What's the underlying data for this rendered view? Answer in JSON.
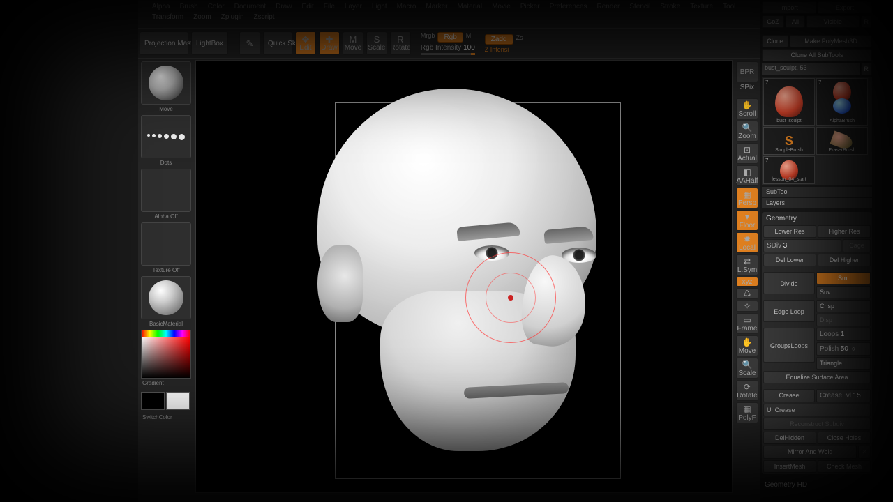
{
  "menu": [
    "Alpha",
    "Brush",
    "Color",
    "Document",
    "Draw",
    "Edit",
    "File",
    "Layer",
    "Light",
    "Macro",
    "Marker",
    "Material",
    "Movie",
    "Picker",
    "Preferences",
    "Render",
    "Stencil",
    "Stroke",
    "Texture",
    "Tool",
    "Transform",
    "Zoom",
    "Zplugin",
    "Zscript"
  ],
  "topbar": {
    "projection": "Projection Master",
    "lightbox": "LightBox",
    "quicksketch": "Quick Sketch",
    "edit": "Edit",
    "draw": "Draw",
    "move": "Move",
    "scale": "Scale",
    "rotate": "Rotate",
    "mrgb": "Mrgb",
    "rgb": "Rgb",
    "m": "M",
    "rgbint_lbl": "Rgb Intensity",
    "rgbint_val": "100",
    "zadd": "Zadd",
    "zs": "Zs",
    "zint": "Z Intensi"
  },
  "left": {
    "brush": "Move",
    "stroke": "Dots",
    "alpha": "Alpha Off",
    "texture": "Texture Off",
    "material": "BasicMaterial",
    "gradient": "Gradient",
    "switch": "SwitchColor"
  },
  "rnav": {
    "bpr": "BPR",
    "spix": "SPix",
    "scroll": "Scroll",
    "zoom": "Zoom",
    "actual": "Actual",
    "aahalf": "AAHalf",
    "persp": "Persp",
    "floor": "Floor",
    "local": "Local",
    "lsym": "L.Sym",
    "xyz": "xyz",
    "frame": "Frame",
    "move": "Move",
    "scale": "Scale",
    "rotate": "Rotate",
    "polyf": "PolyF"
  },
  "rp": {
    "import": "Import",
    "export": "Export",
    "goz": "GoZ",
    "all": "All",
    "visible": "Visible",
    "r": "R",
    "clone": "Clone",
    "makepoly": "Make PolyMesh3D",
    "cloneall": "Clone All SubTools",
    "toolname": "bust_sculpt. 53",
    "subtools": [
      {
        "n": "7",
        "lbl": "bust_sculpt",
        "kind": "head"
      },
      {
        "n": "7",
        "lbl": "bust_sculpt",
        "kind": "head2"
      },
      {
        "n": "",
        "lbl": "AlphaBrush",
        "kind": "sphere"
      },
      {
        "n": "",
        "lbl": "SimpleBrush",
        "kind": "s"
      },
      {
        "n": "",
        "lbl": "EraserBrush",
        "kind": "e"
      },
      {
        "n": "7",
        "lbl": "lesson_04_start",
        "kind": "headsm"
      }
    ],
    "subtool_hdr": "SubTool",
    "layers_hdr": "Layers",
    "geometry": "Geometry",
    "lowerres": "Lower Res",
    "higherres": "Higher Res",
    "sdiv_lbl": "SDiv",
    "sdiv_val": "3",
    "cage": "Cage",
    "dellower": "Del Lower",
    "delhigher": "Del Higher",
    "divide": "Divide",
    "smt": "Smt",
    "suv": "Suv",
    "crisp": "Crisp",
    "disp": "Disp",
    "edgeloop": "Edge Loop",
    "loops_lbl": "Loops",
    "loops_val": "1",
    "groupsloops": "GroupsLoops",
    "polish_lbl": "Polish",
    "polish_val": "50",
    "triangle": "Triangle",
    "equalize": "Equalize Surface Area",
    "crease": "Crease",
    "creaselvl_lbl": "CreaseLvl",
    "creaselvl_val": "15",
    "uncrease": "UnCrease",
    "recon": "Reconstruct Subdiv",
    "delhidden": "DelHidden",
    "closeholes": "Close Holes",
    "mirrorweld": "Mirror And Weld",
    "insertmesh": "InsertMesh",
    "checkmesh": "Check Mesh",
    "geomhd": "Geometry HD"
  }
}
